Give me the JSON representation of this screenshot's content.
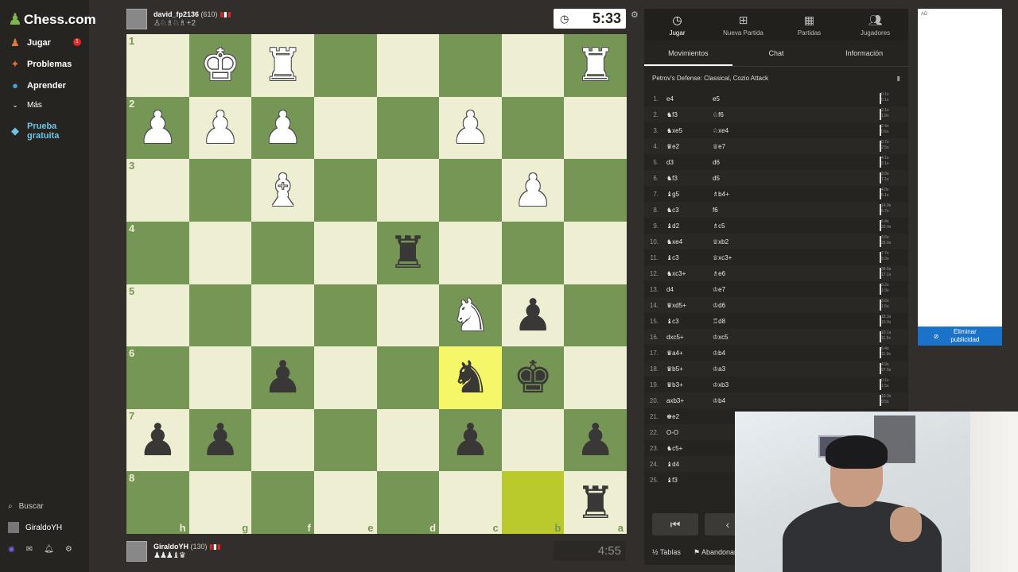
{
  "sidebar": {
    "logo": "Chess.com",
    "items": [
      {
        "label": "Jugar",
        "icon": "play-icon",
        "badge": "1"
      },
      {
        "label": "Problemas",
        "icon": "puzzle-icon"
      },
      {
        "label": "Aprender",
        "icon": "learn-icon"
      },
      {
        "label": "Más",
        "icon": "more-icon"
      },
      {
        "label": "Prueba gratuita",
        "icon": "diamond-icon"
      }
    ],
    "search_label": "Buscar",
    "user_label": "GiraldoYH"
  },
  "top_player": {
    "name": "david_fp2136",
    "rating": "(610)",
    "captured": "♙♘♗♘♗",
    "material": "+2",
    "clock": "5:33"
  },
  "bottom_player": {
    "name": "GiraldoYH",
    "rating": "(130)",
    "captured": "♟♟♟♝♛",
    "clock": "4:55"
  },
  "board": {
    "ranks": [
      "1",
      "2",
      "3",
      "4",
      "5",
      "6",
      "7",
      "8"
    ],
    "files": [
      "h",
      "g",
      "f",
      "e",
      "d",
      "c",
      "b",
      "a"
    ],
    "squares": [
      [
        "",
        "wK",
        "wR",
        "",
        "",
        "",
        "",
        "wR"
      ],
      [
        "wP",
        "wP",
        "wP",
        "",
        "",
        "wP",
        "",
        ""
      ],
      [
        "",
        "",
        "wB",
        "",
        "",
        "",
        "wP",
        ""
      ],
      [
        "",
        "",
        "",
        "",
        "bR",
        "",
        "",
        ""
      ],
      [
        "",
        "",
        "",
        "",
        "",
        "wN",
        "bP",
        ""
      ],
      [
        "",
        "",
        "bP",
        "",
        "",
        "bN",
        "bK",
        ""
      ],
      [
        "bP",
        "bP",
        "",
        "",
        "",
        "bP",
        "",
        "bP"
      ],
      [
        "",
        "",
        "",
        "",
        "",
        "",
        "",
        "bR"
      ]
    ],
    "highlight_last": [
      5,
      5
    ],
    "highlight_from": [
      7,
      6
    ]
  },
  "panel": {
    "top_tabs": [
      {
        "label": "Jugar",
        "icon": "clock-icon"
      },
      {
        "label": "Nueva Partida",
        "icon": "plus-icon"
      },
      {
        "label": "Partidas",
        "icon": "board-icon"
      },
      {
        "label": "Jugadores",
        "icon": "players-icon"
      }
    ],
    "sub_tabs": [
      "Movimientos",
      "Chat",
      "Información"
    ],
    "opening": "Petrov's Defense: Classical, Cozio Attack",
    "moves": [
      {
        "n": "1.",
        "w": "e4",
        "b": "e5",
        "t1": "0.1s",
        "t2": "0.1s"
      },
      {
        "n": "2.",
        "w": "♞f3",
        "b": "♘f6",
        "t1": "2.1s",
        "t2": "1.8s"
      },
      {
        "n": "3.",
        "w": "♞xe5",
        "b": "♘xe4",
        "t1": "2.4s",
        "t2": "0.6s"
      },
      {
        "n": "4.",
        "w": "♛e2",
        "b": "♕e7",
        "t1": "0.7s",
        "t2": "2.5s"
      },
      {
        "n": "5.",
        "w": "d3",
        "b": "d6",
        "t1": "4.1s",
        "t2": "2.1s"
      },
      {
        "n": "6.",
        "w": "♞f3",
        "b": "d5",
        "t1": "3.9s",
        "t2": "7.1s"
      },
      {
        "n": "7.",
        "w": "♝g5",
        "b": "♗b4+",
        "t1": "4.0s",
        "t2": "6.1s"
      },
      {
        "n": "8.",
        "w": "♞c3",
        "b": "f6",
        "t1": "14.9s",
        "t2": "5.7s"
      },
      {
        "n": "9.",
        "w": "♝d2",
        "b": "♗c5",
        "t1": "6.4s",
        "t2": "20.9s"
      },
      {
        "n": "10.",
        "w": "♞xe4",
        "b": "♕xb2",
        "t1": "3.6s",
        "t2": "26.0s"
      },
      {
        "n": "11.",
        "w": "♝c3",
        "b": "♕xc3+",
        "t1": "7.7s",
        "t2": "5.3s"
      },
      {
        "n": "12.",
        "w": "♞xc3+",
        "b": "♗e6",
        "t1": "36.6s",
        "t2": "17.1s"
      },
      {
        "n": "13.",
        "w": "d4",
        "b": "♔e7",
        "t1": "3.2s",
        "t2": "1.0s"
      },
      {
        "n": "14.",
        "w": "♛xd5+",
        "b": "♔d6",
        "t1": "3.6s",
        "t2": "1.5s"
      },
      {
        "n": "15.",
        "w": "♝c3",
        "b": "♖d8",
        "t1": "18.3s",
        "t2": "10.9s"
      },
      {
        "n": "16.",
        "w": "dxc5+",
        "b": "♔xc5",
        "t1": "10.1s",
        "t2": "11.5s"
      },
      {
        "n": "17.",
        "w": "♛a4+",
        "b": "♔b4",
        "t1": "6.4s",
        "t2": "11.9s"
      },
      {
        "n": "18.",
        "w": "♛b5+",
        "b": "♔a3",
        "t1": "4.9s",
        "t2": "27.5s"
      },
      {
        "n": "19.",
        "w": "♛b3+",
        "b": "♔xb3",
        "t1": "0.1s",
        "t2": "1.5s"
      },
      {
        "n": "20.",
        "w": "axb3+",
        "b": "♔b4",
        "t1": "19.3s",
        "t2": "9.5s"
      },
      {
        "n": "21.",
        "w": "♚e2",
        "b": "",
        "t1": "",
        "t2": ""
      },
      {
        "n": "22.",
        "w": "O-O",
        "b": "",
        "t1": "",
        "t2": ""
      },
      {
        "n": "23.",
        "w": "♞c5+",
        "b": "",
        "t1": "",
        "t2": ""
      },
      {
        "n": "24.",
        "w": "♝d4",
        "b": "",
        "t1": "",
        "t2": ""
      },
      {
        "n": "25.",
        "w": "♝f3",
        "b": "",
        "t1": "",
        "t2": ""
      }
    ],
    "actions": [
      "Tablas",
      "Abandonar"
    ]
  },
  "ad": {
    "label": "AD",
    "remove_label": "Eliminar publicidad"
  }
}
